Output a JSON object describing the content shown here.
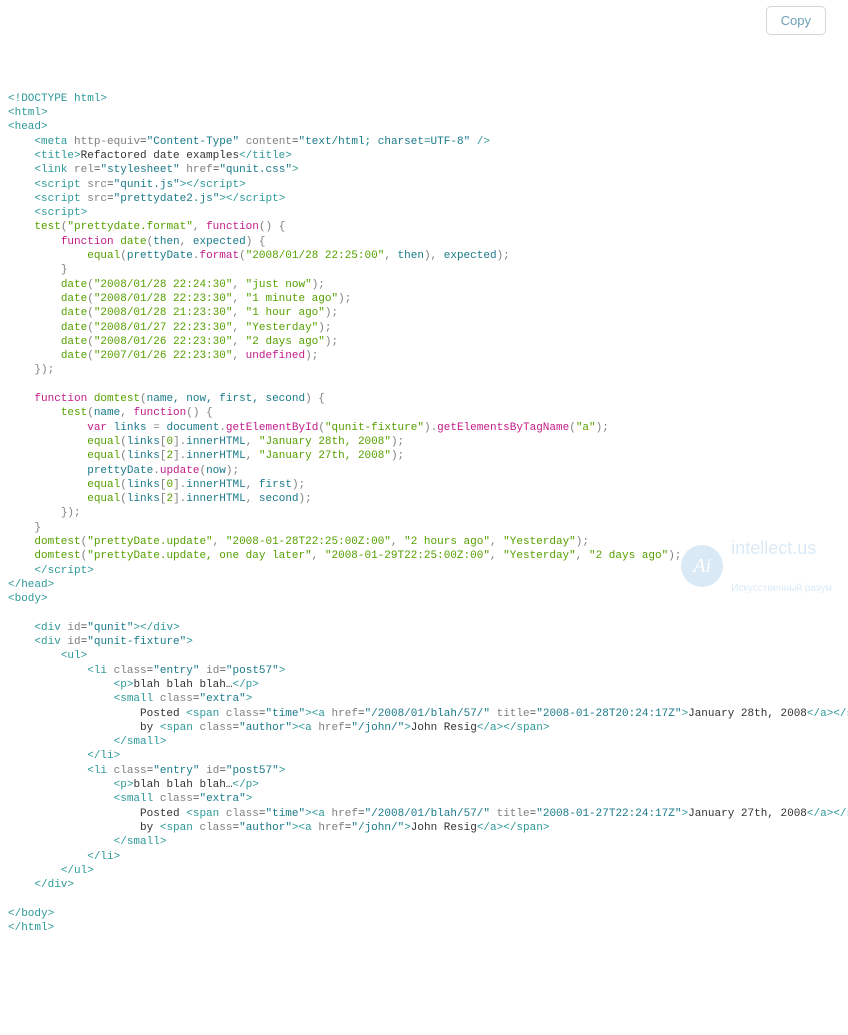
{
  "copyLabel": "Copy",
  "watermark": {
    "badge": "Ai",
    "line1": "intellect.us",
    "line2": "Искусственный разум"
  },
  "code": {
    "doctype": "<!DOCTYPE html>",
    "title": "Refactored date examples",
    "metaEquiv": "Content-Type",
    "metaContent": "text/html; charset=UTF-8",
    "relVal": "stylesheet",
    "cssHref": "qunit.css",
    "scriptSrc1": "qunit.js",
    "scriptSrc2": "prettydate2.js",
    "testName": "prettydate.format",
    "funcName": "date",
    "paramThen": "then",
    "paramExpected": "expected",
    "equalFn": "equal",
    "prettyObj": "prettyDate",
    "formatM": "format",
    "baseDate": "\"2008/01/28 22:25:00\"",
    "d1": "\"2008/01/28 22:24:30\"",
    "r1": "\"just now\"",
    "d2": "\"2008/01/28 22:23:30\"",
    "r2": "\"1 minute ago\"",
    "d3": "\"2008/01/28 21:23:30\"",
    "r3": "\"1 hour ago\"",
    "d4": "\"2008/01/27 22:23:30\"",
    "r4": "\"Yesterday\"",
    "d5": "\"2008/01/26 22:23:30\"",
    "r5": "\"2 days ago\"",
    "d6": "\"2007/01/26 22:23:30\"",
    "r6": "undefined",
    "domFn": "domtest",
    "domArgs": "name, now, first, second",
    "testFn": "test",
    "linksVar": "links",
    "docObj": "document",
    "gById": "getElementById",
    "fixtureId": "\"qunit-fixture\"",
    "gByTag": "getElementsByTagName",
    "aTag": "\"a\"",
    "innerH": "innerHTML",
    "idx0": "0",
    "idx2": "2",
    "jan28": "\"January 28th, 2008\"",
    "jan27": "\"January 27th, 2008\"",
    "updateM": "update",
    "nowArg": "now",
    "firstArg": "first",
    "secondArg": "second",
    "nameArg": "name",
    "dt1Name": "\"prettyDate.update\"",
    "dt1Now": "\"2008-01-28T22:25:00Z:00\"",
    "dt1First": "\"2 hours ago\"",
    "dt1Second": "\"Yesterday\"",
    "dt2Name": "\"prettyDate.update, one day later\"",
    "dt2Now": "\"2008-01-29T22:25:00Z:00\"",
    "dt2First": "\"Yesterday\"",
    "dt2Second": "\"2 days ago\"",
    "divQunit": "qunit",
    "divFixture": "qunit-fixture",
    "entryClass": "entry",
    "postId": "post57",
    "blah": "blah blah blah…",
    "extraClass": "extra",
    "postedText": "Posted ",
    "byText": "by ",
    "timeClass": "time",
    "authorClass": "author",
    "href1": "/2008/01/blah/57/",
    "title1": "2008-01-28T20:24:17Z",
    "linkText1": "January 28th, 2008",
    "title2": "2008-01-27T22:24:17Z",
    "linkText2": "January 27th, 2008",
    "hrefJohn": "/john/",
    "johnText": "John Resig"
  }
}
